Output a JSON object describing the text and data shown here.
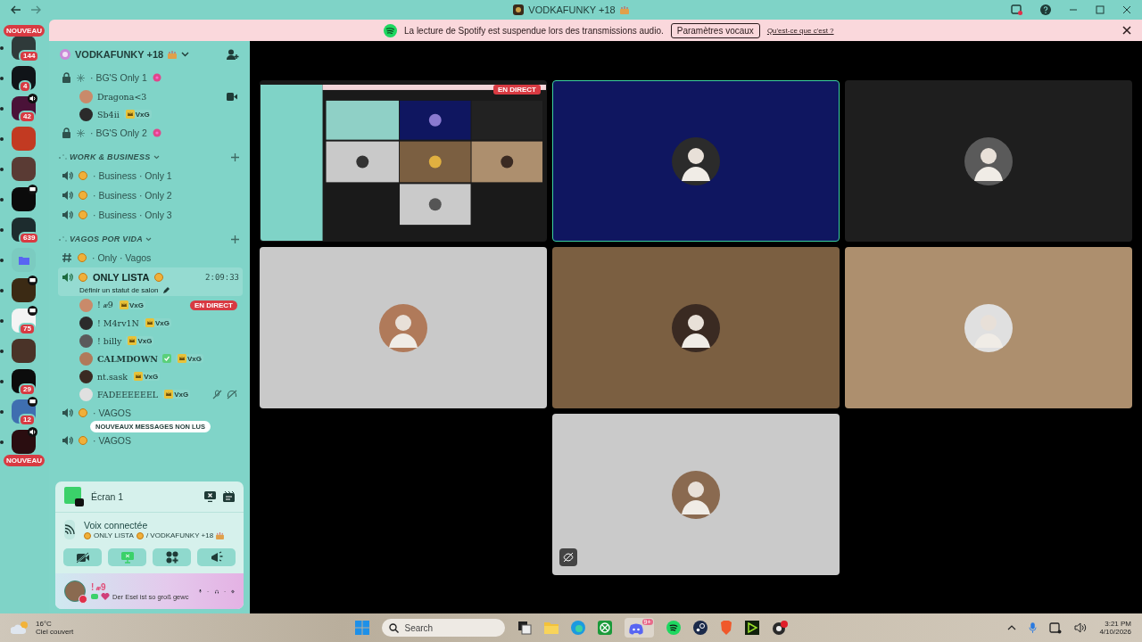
{
  "window": {
    "title": "VODKAFUNKY +18"
  },
  "notice": {
    "text": "La lecture de Spotify est suspendue lors des transmissions audio.",
    "button": "Paramètres vocaux",
    "link": "Qu'est-ce que c'est ?"
  },
  "new_top": "NOUVEAU",
  "new_bottom": "NOUVEAU",
  "servers": [
    {
      "kind": "server",
      "color": "#2f3a3a",
      "badge": "144",
      "speaking": false,
      "streaming": false
    },
    {
      "kind": "server",
      "color": "#101418",
      "badge": "4",
      "speaking": false,
      "streaming": false
    },
    {
      "kind": "server",
      "color": "#4a1238",
      "badge": "42",
      "speaking": true,
      "streaming": false
    },
    {
      "kind": "server",
      "color": "#c23a22",
      "speaking": false,
      "streaming": false
    },
    {
      "kind": "server",
      "color": "#5a3b34",
      "speaking": false,
      "streaming": false
    },
    {
      "kind": "server",
      "color": "#0b0b0b",
      "speaking": false,
      "streaming": true
    },
    {
      "kind": "server",
      "color": "#1d2c2e",
      "badge": "639",
      "speaking": false,
      "streaming": false
    },
    {
      "kind": "folder",
      "color": "#7bcbc0",
      "speaking": false,
      "streaming": false
    },
    {
      "kind": "server",
      "color": "#3b2a14",
      "speaking": false,
      "streaming": true
    },
    {
      "kind": "server",
      "color": "#f4f4f4",
      "badge": "75",
      "speaking": false,
      "streaming": true
    },
    {
      "kind": "server",
      "color": "#4a3328",
      "speaking": false,
      "streaming": false
    },
    {
      "kind": "server",
      "color": "#0c0c0c",
      "badge": "29",
      "speaking": false,
      "streaming": false
    },
    {
      "kind": "server",
      "color": "#3f6fb0",
      "badge": "12",
      "speaking": false,
      "streaming": true
    },
    {
      "kind": "server",
      "color": "#2a0d10",
      "speaking": true,
      "streaming": false
    }
  ],
  "server_header": {
    "name": "VODKAFUNKY +18"
  },
  "channels": [
    {
      "kind": "locked",
      "name": "· BG'S Only 1",
      "selected": false,
      "members": [
        {
          "name": "Dragona<3",
          "camera": true,
          "verified": false,
          "muted": false,
          "deafened": false
        },
        {
          "name": "Sb4ii",
          "tag": "VxG",
          "camera": false,
          "verified": false,
          "muted": false,
          "deafened": false
        }
      ]
    },
    {
      "kind": "locked",
      "name": "· BG'S Only 2",
      "selected": false
    },
    {
      "kind": "category",
      "name": "WORK & BUSINESS"
    },
    {
      "kind": "voice",
      "name": "· Business · Only 1",
      "selected": false
    },
    {
      "kind": "voice",
      "name": "· Business · Only 2",
      "selected": false
    },
    {
      "kind": "voice",
      "name": "· Business · Only 3",
      "selected": false
    },
    {
      "kind": "category",
      "name": "VAGOS POR VIDA"
    },
    {
      "kind": "text",
      "name": "· Only · Vagos",
      "selected": false
    },
    {
      "kind": "voice",
      "name": "ONLY LISTA",
      "selected": true,
      "time": "2:09:33",
      "status": "Définir un statut de salon",
      "members": [
        {
          "name": "! 𝓍9",
          "tag": "VxG",
          "live": "EN DIRECT",
          "camera": false,
          "verified": false,
          "muted": false,
          "deafened": false
        },
        {
          "name": "! M4rv1N",
          "tag": "VxG",
          "camera": false,
          "verified": false,
          "muted": false,
          "deafened": false
        },
        {
          "name": "! billy",
          "tag": "VxG",
          "camera": false,
          "verified": false,
          "muted": false,
          "deafened": false
        },
        {
          "name": "CALMDOWN",
          "tag": "VxG",
          "camera": false,
          "verified": true,
          "muted": false,
          "deafened": false
        },
        {
          "name": "nt.sask",
          "tag": "VxG",
          "camera": false,
          "verified": false,
          "muted": false,
          "deafened": false
        },
        {
          "name": "FADEEEEEEL",
          "tag": "VxG",
          "camera": false,
          "verified": false,
          "muted": true,
          "deafened": true
        }
      ]
    },
    {
      "kind": "voice",
      "name": "· VAGOS",
      "selected": false
    },
    {
      "kind": "voice",
      "name": "· VAGOS",
      "selected": false
    }
  ],
  "unread_pill": "NOUVEAUX MESSAGES NON LUS",
  "stream": {
    "title": "Écran 1"
  },
  "voice": {
    "status": "Voix connectée",
    "channel": "ONLY LISTA",
    "server": "/ VODKAFUNKY +18"
  },
  "controls": [
    {
      "kind": "camera",
      "on": false
    },
    {
      "kind": "screen",
      "on": true
    },
    {
      "kind": "activity",
      "on": false
    },
    {
      "kind": "soundboard",
      "on": false
    }
  ],
  "user": {
    "name": "! 𝓍9",
    "status": "Der Esel ist so groß gewc"
  },
  "tiles": [
    {
      "kind": "stream",
      "live": "EN DIRECT",
      "color": "#1a1a1a",
      "selected": false,
      "hidden_icon": false
    },
    {
      "kind": "avatar",
      "color": "#0f1660",
      "selected": true,
      "hidden_icon": false
    },
    {
      "kind": "avatar",
      "color": "#1e1e1e",
      "selected": false,
      "hidden_icon": false
    },
    {
      "kind": "avatar",
      "color": "#c9c9c9",
      "selected": false,
      "hidden_icon": false
    },
    {
      "kind": "avatar",
      "color": "#7b5f41",
      "selected": false,
      "hidden_icon": false
    },
    {
      "kind": "avatar",
      "color": "#ad8f6e",
      "selected": false,
      "hidden_icon": false
    },
    {
      "kind": "avatar",
      "color": "#cacaca",
      "selected": false,
      "hidden_icon": true
    }
  ],
  "taskbar": {
    "temperature": "16°C",
    "weather": "Ciel couvert",
    "search": "Search",
    "discord_badge": "9+",
    "time": "3:21 PM",
    "date": "4/10/2026"
  }
}
